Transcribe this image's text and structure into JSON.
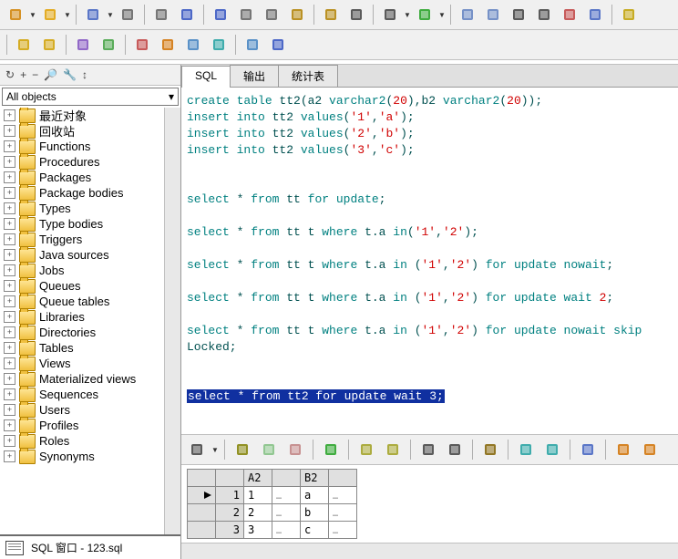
{
  "toolbar1_icons": [
    "folder-open",
    "folder-open-yellow",
    "save",
    "print",
    "print-preview",
    "undo",
    "redo",
    "cut",
    "copy",
    "paste",
    "clipboard",
    "find",
    "find-next",
    "exec-green",
    "exec-doc",
    "doc",
    "indent-left",
    "indent-right",
    "doc-red",
    "doc-blue",
    "chat"
  ],
  "toolbar2_icons": [
    "key",
    "gear",
    "wand",
    "cylinder-green",
    "cylinder-red-up",
    "cylinder-orange",
    "cylinder-sql",
    "cylinder-teal",
    "cylinder-lock",
    "help"
  ],
  "left_tool_icons": [
    "refresh",
    "plus",
    "minus",
    "binoculars",
    "wrench",
    "sort"
  ],
  "objects_combo": "All objects",
  "tree": [
    "最近对象",
    "回收站",
    "Functions",
    "Procedures",
    "Packages",
    "Package bodies",
    "Types",
    "Type bodies",
    "Triggers",
    "Java sources",
    "Jobs",
    "Queues",
    "Queue tables",
    "Libraries",
    "Directories",
    "Tables",
    "Views",
    "Materialized views",
    "Sequences",
    "Users",
    "Profiles",
    "Roles",
    "Synonyms"
  ],
  "window_title": "SQL 窗口 - 123.sql",
  "tabs": [
    "SQL",
    "输出",
    "统计表"
  ],
  "editor_lines": [
    [
      [
        "kw",
        "create table"
      ],
      [
        "txt",
        " tt2(a2 "
      ],
      [
        "kw",
        "varchar2"
      ],
      [
        "txt",
        "("
      ],
      [
        "num",
        "20"
      ],
      [
        "txt",
        "),b2 "
      ],
      [
        "kw",
        "varchar2"
      ],
      [
        "txt",
        "("
      ],
      [
        "num",
        "20"
      ],
      [
        "txt",
        "));"
      ]
    ],
    [
      [
        "kw",
        "insert into"
      ],
      [
        "txt",
        " tt2 "
      ],
      [
        "kw",
        "values"
      ],
      [
        "txt",
        "("
      ],
      [
        "str",
        "'1'"
      ],
      [
        "txt",
        ","
      ],
      [
        "str",
        "'a'"
      ],
      [
        "txt",
        ");"
      ]
    ],
    [
      [
        "kw",
        "insert into"
      ],
      [
        "txt",
        " tt2 "
      ],
      [
        "kw",
        "values"
      ],
      [
        "txt",
        "("
      ],
      [
        "str",
        "'2'"
      ],
      [
        "txt",
        ","
      ],
      [
        "str",
        "'b'"
      ],
      [
        "txt",
        ");"
      ]
    ],
    [
      [
        "kw",
        "insert into"
      ],
      [
        "txt",
        " tt2 "
      ],
      [
        "kw",
        "values"
      ],
      [
        "txt",
        "("
      ],
      [
        "str",
        "'3'"
      ],
      [
        "txt",
        ","
      ],
      [
        "str",
        "'c'"
      ],
      [
        "txt",
        ");"
      ]
    ],
    [],
    [],
    [
      [
        "kw",
        "select"
      ],
      [
        "txt",
        " * "
      ],
      [
        "kw",
        "from"
      ],
      [
        "txt",
        " tt "
      ],
      [
        "kw",
        "for update"
      ],
      [
        "txt",
        ";"
      ]
    ],
    [],
    [
      [
        "kw",
        "select"
      ],
      [
        "txt",
        " * "
      ],
      [
        "kw",
        "from"
      ],
      [
        "txt",
        " tt t "
      ],
      [
        "kw",
        "where"
      ],
      [
        "txt",
        " t.a "
      ],
      [
        "kw",
        "in"
      ],
      [
        "txt",
        "("
      ],
      [
        "str",
        "'1'"
      ],
      [
        "txt",
        ","
      ],
      [
        "str",
        "'2'"
      ],
      [
        "txt",
        ");"
      ]
    ],
    [],
    [
      [
        "kw",
        "select"
      ],
      [
        "txt",
        " * "
      ],
      [
        "kw",
        "from"
      ],
      [
        "txt",
        " tt t "
      ],
      [
        "kw",
        "where"
      ],
      [
        "txt",
        " t.a "
      ],
      [
        "kw",
        "in"
      ],
      [
        "txt",
        " ("
      ],
      [
        "str",
        "'1'"
      ],
      [
        "txt",
        ","
      ],
      [
        "str",
        "'2'"
      ],
      [
        "txt",
        ") "
      ],
      [
        "kw",
        "for update nowait"
      ],
      [
        "txt",
        ";"
      ]
    ],
    [],
    [
      [
        "kw",
        "select"
      ],
      [
        "txt",
        " * "
      ],
      [
        "kw",
        "from"
      ],
      [
        "txt",
        " tt t "
      ],
      [
        "kw",
        "where"
      ],
      [
        "txt",
        " t.a "
      ],
      [
        "kw",
        "in"
      ],
      [
        "txt",
        " ("
      ],
      [
        "str",
        "'1'"
      ],
      [
        "txt",
        ","
      ],
      [
        "str",
        "'2'"
      ],
      [
        "txt",
        ") "
      ],
      [
        "kw",
        "for update wait"
      ],
      [
        "txt",
        " "
      ],
      [
        "num",
        "2"
      ],
      [
        "txt",
        ";"
      ]
    ],
    [],
    [
      [
        "kw",
        "select"
      ],
      [
        "txt",
        " * "
      ],
      [
        "kw",
        "from"
      ],
      [
        "txt",
        " tt t "
      ],
      [
        "kw",
        "where"
      ],
      [
        "txt",
        " t.a "
      ],
      [
        "kw",
        "in"
      ],
      [
        "txt",
        " ("
      ],
      [
        "str",
        "'1'"
      ],
      [
        "txt",
        ","
      ],
      [
        "str",
        "'2'"
      ],
      [
        "txt",
        ") "
      ],
      [
        "kw",
        "for update nowait skip"
      ],
      [
        "txt",
        " Locked;"
      ]
    ],
    [],
    [],
    [
      [
        "sel",
        "select * from tt2 for update wait 3;"
      ]
    ]
  ],
  "result_toolbar_icons": [
    "grid",
    "lock",
    "add",
    "del",
    "check",
    "undo2",
    "redo2",
    "find2",
    "first",
    "bookmark",
    "link",
    "list",
    "save2",
    "cyl1",
    "cyl2"
  ],
  "grid": {
    "cols": [
      "A2",
      "B2"
    ],
    "rows": [
      [
        "1",
        "a"
      ],
      [
        "2",
        "b"
      ],
      [
        "3",
        "c"
      ]
    ]
  }
}
